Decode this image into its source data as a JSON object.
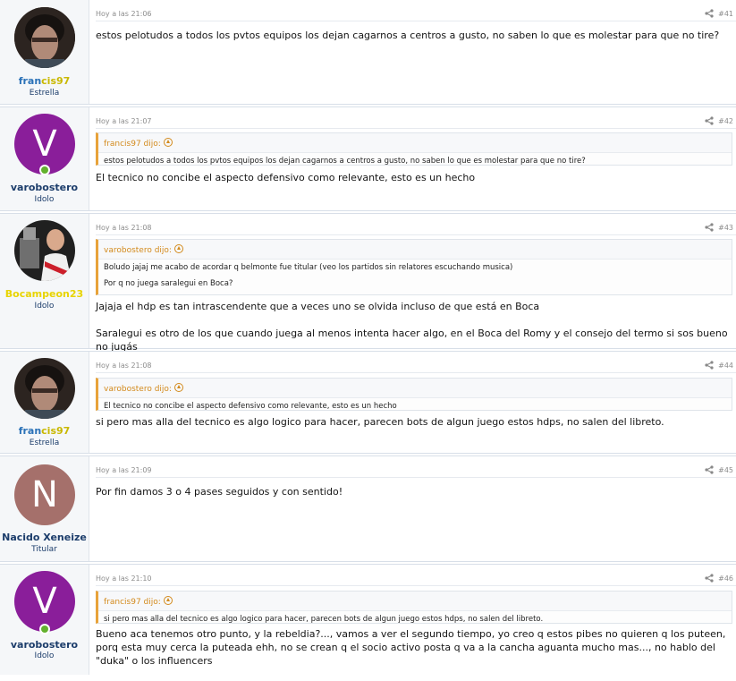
{
  "posts": [
    {
      "author": "francis97",
      "author_parts": [
        "fran",
        "cis97"
      ],
      "title": "Estrella",
      "time": "Hoy a las 21:06",
      "number": "#41",
      "body": [
        "estos pelotudos a todos los pvtos equipos los dejan cagarnos a centros a gusto, no saben lo que es molestar para que no tire?"
      ]
    },
    {
      "author": "varobostero",
      "avatar_letter": "V",
      "title": "Idolo",
      "time": "Hoy a las 21:07",
      "number": "#42",
      "quote": {
        "header": "francis97 dijo:",
        "lines": [
          "estos pelotudos a todos los pvtos equipos los dejan cagarnos a centros a gusto, no saben lo que es molestar para que no tire?"
        ]
      },
      "body": [
        "El tecnico no concibe el aspecto defensivo como relevante, esto es un hecho"
      ]
    },
    {
      "author": "Bocampeon23",
      "title": "Idolo",
      "time": "Hoy a las 21:08",
      "number": "#43",
      "quote": {
        "header": "varobostero dijo:",
        "lines": [
          "Boludo jajaj me acabo de acordar q belmonte fue titular (veo los partidos sin relatores escuchando musica)",
          "Por q no juega saralegui en Boca?"
        ]
      },
      "body": [
        "Jajaja el hdp es tan intrascendente que a veces uno se olvida incluso de que está en Boca",
        "Saralegui es otro de los que cuando juega al menos intenta hacer algo, en el Boca del Romy y el consejo del termo si sos bueno no jugás"
      ]
    },
    {
      "author": "francis97",
      "author_parts": [
        "fran",
        "cis97"
      ],
      "title": "Estrella",
      "time": "Hoy a las 21:08",
      "number": "#44",
      "quote": {
        "header": "varobostero dijo:",
        "lines": [
          "El tecnico no concibe el aspecto defensivo como relevante, esto es un hecho"
        ]
      },
      "body": [
        "si pero mas alla del tecnico es algo logico para hacer, parecen bots de algun juego estos hdps, no salen del libreto."
      ]
    },
    {
      "author": "Nacido Xeneize",
      "avatar_letter": "N",
      "title": "Titular",
      "time": "Hoy a las 21:09",
      "number": "#45",
      "body": [
        "Por fin damos 3 o 4 pases seguidos y con sentido!"
      ]
    },
    {
      "author": "varobostero",
      "avatar_letter": "V",
      "title": "Idolo",
      "time": "Hoy a las 21:10",
      "number": "#46",
      "quote": {
        "header": "francis97 dijo:",
        "lines": [
          "si pero mas alla del tecnico es algo logico para hacer, parecen bots de algun juego estos hdps, no salen del libreto."
        ]
      },
      "body": [
        "Bueno aca tenemos otro punto, y la rebeldia?..., vamos a ver el segundo tiempo, yo creo q estos pibes no quieren q los puteen, porq esta muy cerca la puteada ehh, no se crean q el socio activo posta q va a la cancha aguanta mucho mas..., no hablo del \"duka\" o los influencers"
      ]
    }
  ],
  "colors": {
    "francis_blue": "#2b72b8",
    "francis_yellow": "#c9b800",
    "bocampeon": "#e8d400",
    "varobostero_avatar": "#8a1e9a",
    "nacido_avatar": "#a5706b",
    "online": "#63b12e",
    "quote_accent": "#e8a33a"
  },
  "icons": {
    "share": "share-icon",
    "quote_link": "arrow-up-circle-icon",
    "online": "online-status-icon"
  }
}
